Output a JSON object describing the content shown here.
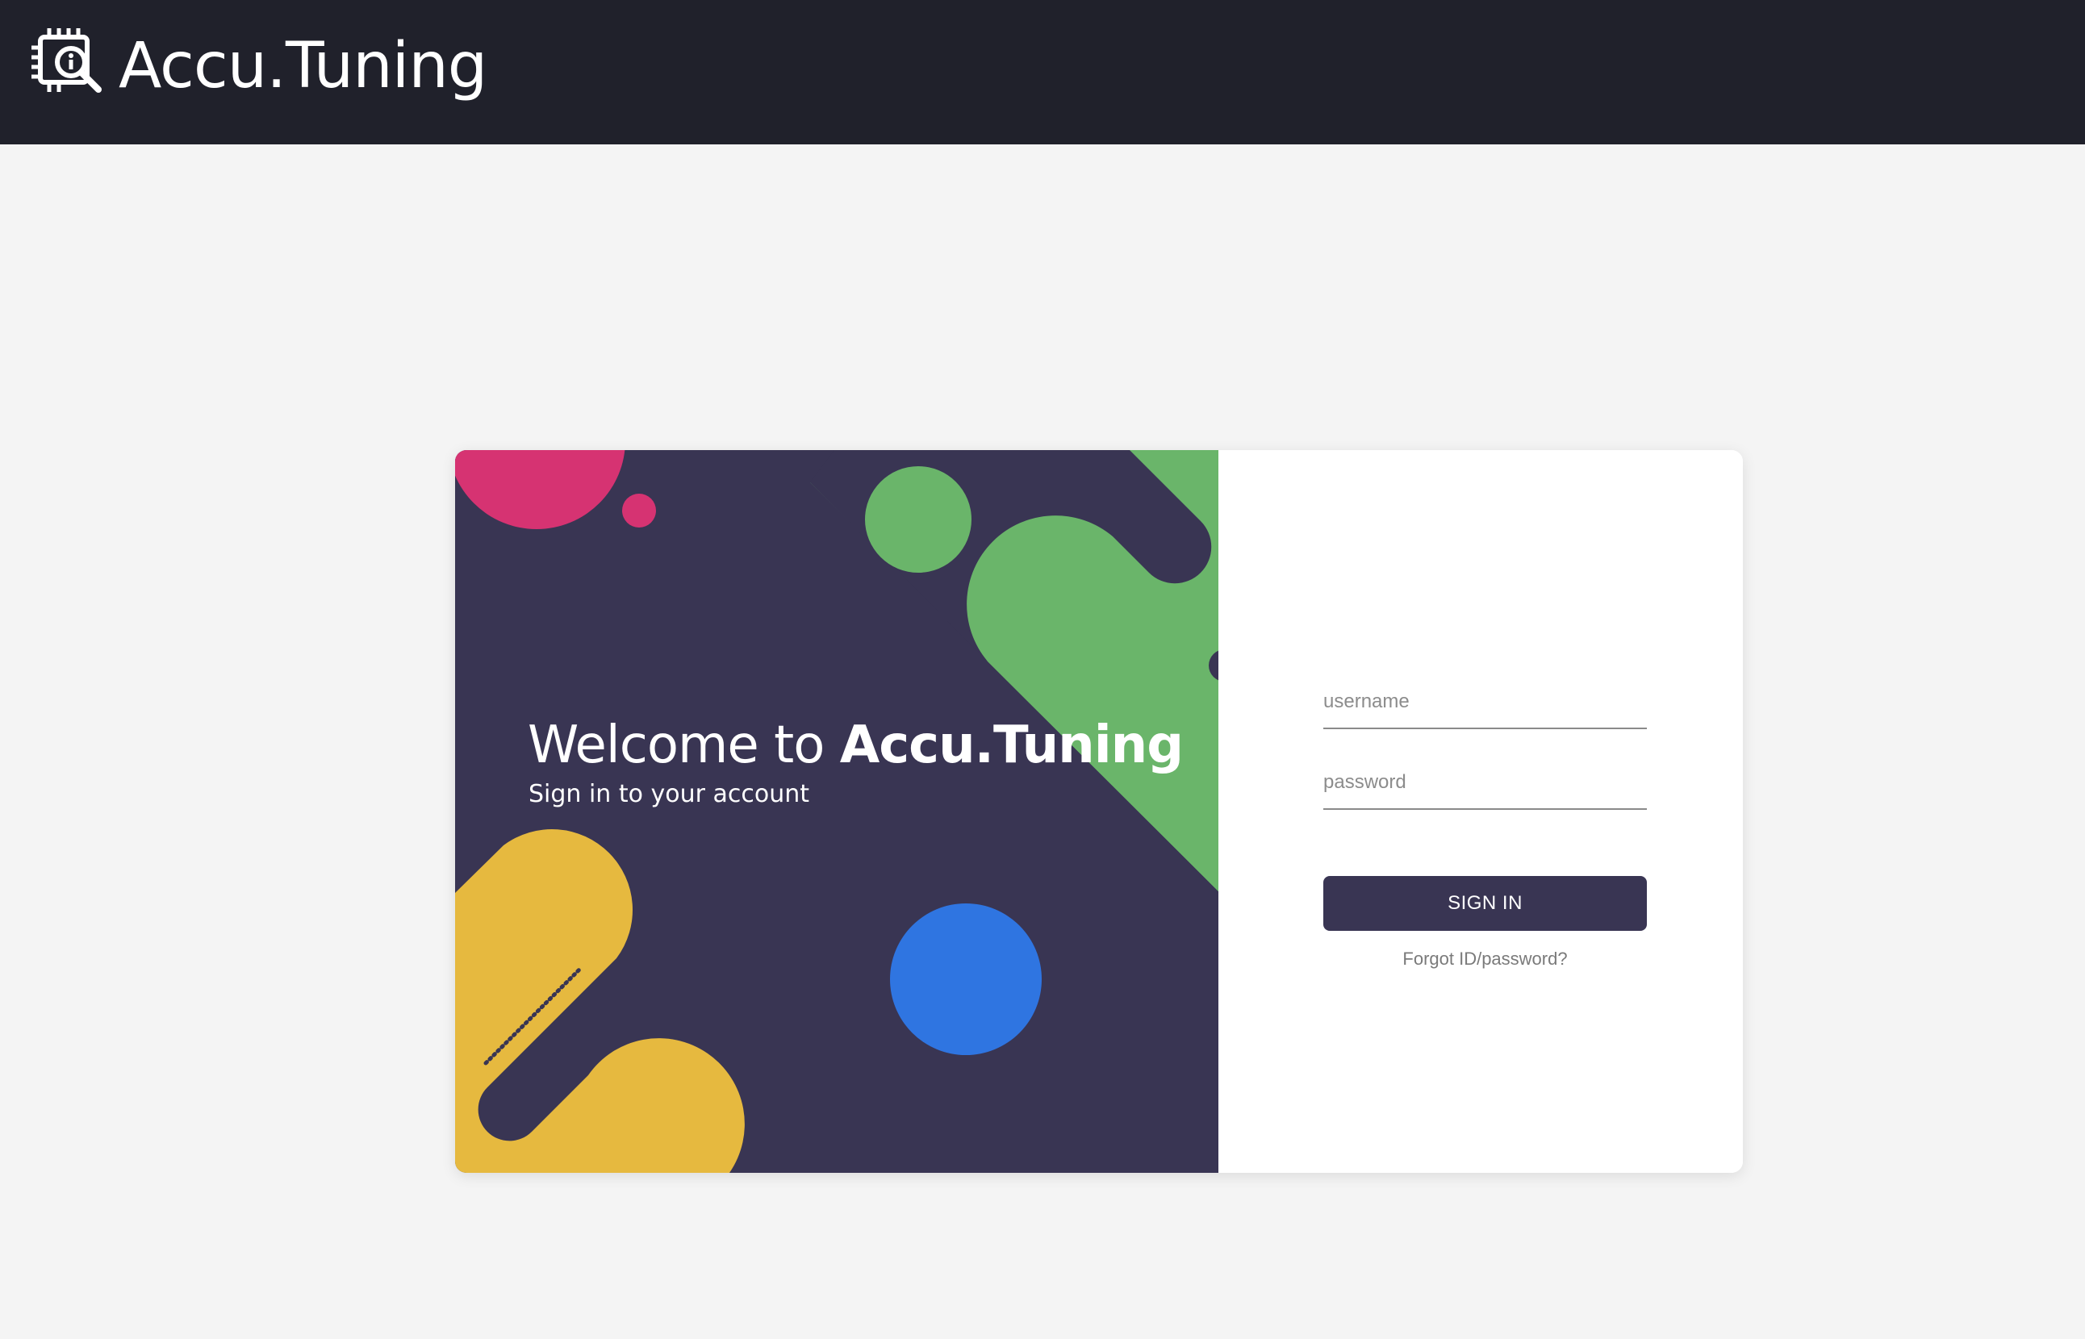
{
  "header": {
    "app_name": "Accu.Tuning",
    "logo_icon": "chip-search-icon",
    "background_color": "#20212b"
  },
  "welcome": {
    "prefix": "Welcome to ",
    "brand": "Accu.Tuning",
    "subtitle": "Sign in to your account"
  },
  "login_form": {
    "username_placeholder": "username",
    "password_placeholder": "password",
    "signin_label": "SIGN IN",
    "forgot_link": "Forgot ID/password?"
  },
  "colors": {
    "panel": "#393553",
    "accent_green": "#6ab56a",
    "accent_pink": "#d63372",
    "accent_yellow": "#e6b93f",
    "accent_blue": "#2f75e1",
    "button": "#393553"
  }
}
